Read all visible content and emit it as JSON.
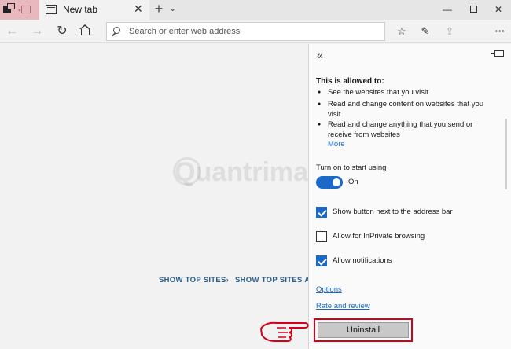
{
  "tabbar": {
    "tab_title": "New tab",
    "close_glyph": "✕",
    "new_tab_glyph": "+",
    "tab_menu_glyph": "⌄"
  },
  "window_controls": {
    "minimize": "—",
    "maximize": "",
    "close": "✕"
  },
  "navbar": {
    "back_glyph": "←",
    "forward_glyph": "→",
    "refresh_glyph": "↻",
    "address_placeholder": "Search or enter web address",
    "favorites_glyph": "☆",
    "notes_glyph": "✎",
    "share_glyph": "⇪",
    "more_glyph": "···"
  },
  "page": {
    "top_sites_1": "SHOW TOP SITES›",
    "top_sites_2": "SHOW TOP SITES AND",
    "watermark": "Quantrimang"
  },
  "panel": {
    "collapse_glyph": "«",
    "allowed_heading": "This is allowed to:",
    "permissions": [
      "See the websites that you visit",
      "Read and change content on websites that you visit",
      "Read and change anything that you send or receive from websites"
    ],
    "more_link": "More",
    "turn_on_label": "Turn on to start using",
    "toggle_state": "On",
    "checkboxes": [
      {
        "label": "Show button next to the address bar",
        "checked": true
      },
      {
        "label": "Allow for InPrivate browsing",
        "checked": false
      },
      {
        "label": "Allow notifications",
        "checked": true
      }
    ],
    "options_link": "Options",
    "rate_link": "Rate and review",
    "uninstall_label": "Uninstall"
  },
  "colors": {
    "accent": "#1b6ac9",
    "highlight_frame": "#d4001a",
    "tab_icons_bg": "#e8b8bf"
  }
}
